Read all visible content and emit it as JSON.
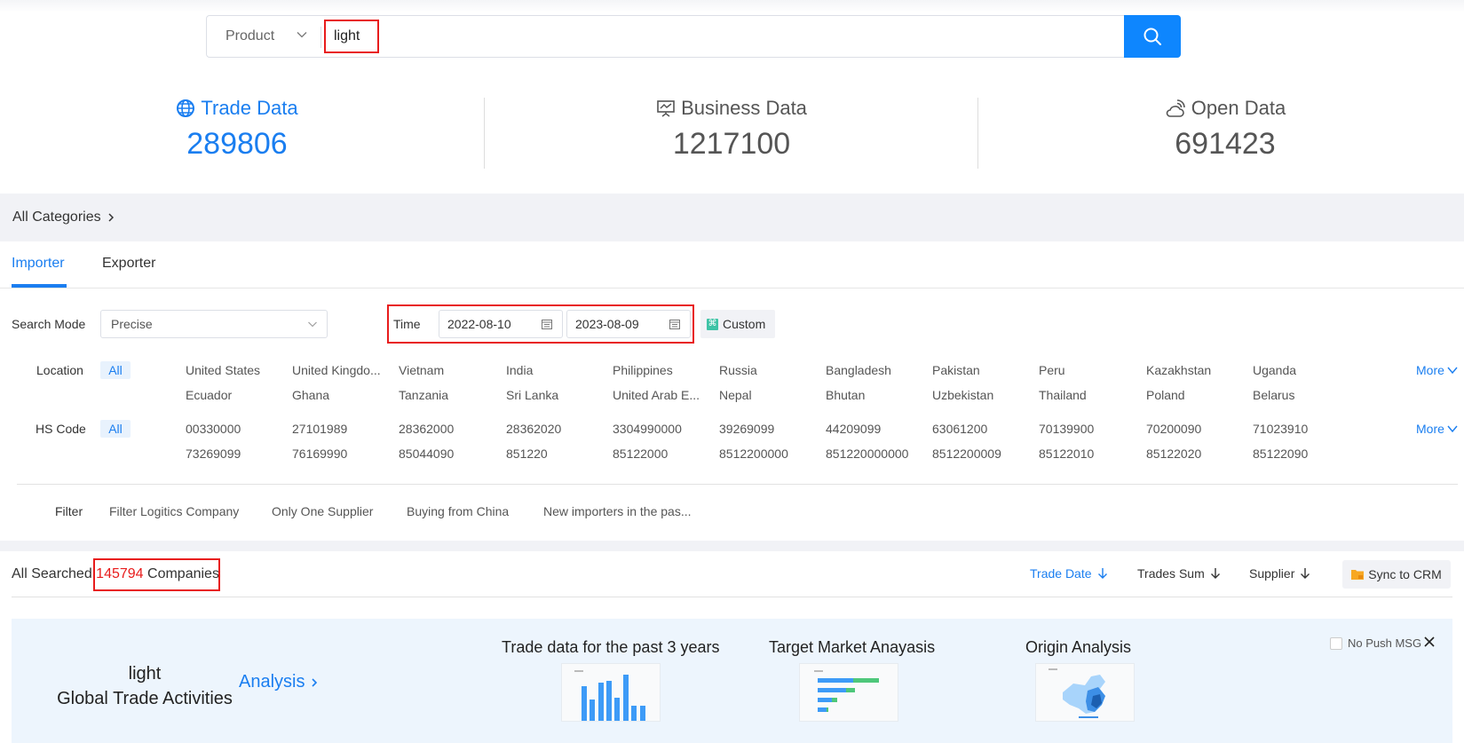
{
  "search": {
    "type_label": "Product",
    "query": "light"
  },
  "stats": [
    {
      "label": "Trade Data",
      "value": "289806",
      "icon": "globe-icon",
      "active": true
    },
    {
      "label": "Business Data",
      "value": "1217100",
      "icon": "presentation-chart-icon",
      "active": false
    },
    {
      "label": "Open Data",
      "value": "691423",
      "icon": "cloud-signal-icon",
      "active": false
    }
  ],
  "categories": {
    "label": "All Categories"
  },
  "tabs": [
    {
      "label": "Importer",
      "active": true
    },
    {
      "label": "Exporter",
      "active": false
    }
  ],
  "search_mode": {
    "label": "Search Mode",
    "value": "Precise"
  },
  "time": {
    "label": "Time",
    "start": "2022-08-10",
    "end": "2023-08-09",
    "custom_label": "Custom"
  },
  "location": {
    "label": "Location",
    "all_label": "All",
    "options": [
      "United States",
      "United Kingdo...",
      "Vietnam",
      "India",
      "Philippines",
      "Russia",
      "Bangladesh",
      "Pakistan",
      "Peru",
      "Kazakhstan",
      "Uganda",
      "Ecuador",
      "Ghana",
      "Tanzania",
      "Sri Lanka",
      "United Arab E...",
      "Nepal",
      "Bhutan",
      "Uzbekistan",
      "Thailand",
      "Poland",
      "Belarus"
    ],
    "more_label": "More"
  },
  "hs_code": {
    "label": "HS Code",
    "all_label": "All",
    "options": [
      "00330000",
      "27101989",
      "28362000",
      "28362020",
      "3304990000",
      "39269099",
      "44209099",
      "63061200",
      "70139900",
      "70200090",
      "71023910",
      "73269099",
      "76169990",
      "85044090",
      "851220",
      "85122000",
      "8512200000",
      "851220000000",
      "8512200009",
      "85122010",
      "85122020",
      "85122090"
    ],
    "more_label": "More"
  },
  "filter": {
    "label": "Filter",
    "options": [
      "Filter Logitics Company",
      "Only One Supplier",
      "Buying from China",
      "New importers in the pas..."
    ]
  },
  "results": {
    "prefix": "All Searched",
    "count": "145794",
    "suffix": "Companies",
    "sorts": [
      {
        "label": "Trade Date",
        "active": true
      },
      {
        "label": "Trades Sum",
        "active": false
      },
      {
        "label": "Supplier",
        "active": false
      }
    ],
    "sync_label": "Sync to CRM"
  },
  "analysis_panel": {
    "keyword": "light",
    "subtitle": "Global Trade Activities",
    "link_label": "Analysis",
    "cards": [
      {
        "title": "Trade data for the past 3 years",
        "thumb": "bar-chart-thumbnail"
      },
      {
        "title": "Target Market Anayasis",
        "thumb": "stacked-bar-thumbnail"
      },
      {
        "title": "Origin Analysis",
        "thumb": "china-map-thumbnail"
      }
    ],
    "no_push_label": "No Push MSG"
  }
}
